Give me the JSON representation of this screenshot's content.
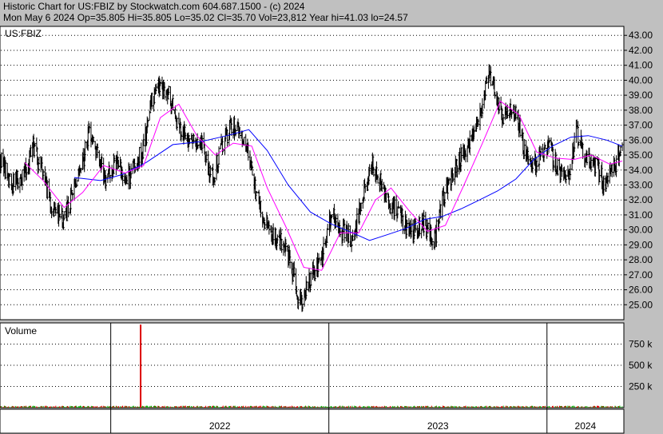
{
  "header": {
    "line1": "Historic Chart for US:FBIZ by Stockwatch.com 604.687.1500 - (c) 2024",
    "line2": "Mon May  6 2024  Op=35.805  Hi=35.805  Lo=35.02  Cl=35.70  Vol=23,812  Year hi=41.03  lo=24.57"
  },
  "chart_data": {
    "type": "line",
    "symbol_label": "US:FBIZ",
    "volume_label": "Volume",
    "price_axis": {
      "ylim": [
        24.0,
        43.6
      ],
      "ticks": [
        25,
        26,
        27,
        28,
        29,
        30,
        31,
        32,
        33,
        34,
        35,
        36,
        37,
        38,
        39,
        40,
        41,
        42,
        43
      ],
      "tick_labels": [
        "25.00",
        "26.00",
        "27.00",
        "28.00",
        "29.00",
        "30.00",
        "31.00",
        "32.00",
        "33.00",
        "34.00",
        "35.00",
        "36.00",
        "37.00",
        "38.00",
        "39.00",
        "40.00",
        "41.00",
        "42.00",
        "43.00"
      ]
    },
    "volume_axis": {
      "ylim": [
        0,
        1000
      ],
      "ticks": [
        250,
        500,
        750
      ],
      "tick_labels": [
        "250 k",
        "500 k",
        "750 k"
      ]
    },
    "x_axis": {
      "start": "2021-07-01",
      "end": "2024-05-06",
      "year_labels": [
        {
          "label": "2022",
          "date": "2022-01-01"
        },
        {
          "label": "2023",
          "date": "2023-01-01"
        },
        {
          "label": "2024",
          "date": "2024-01-01"
        }
      ]
    },
    "colors": {
      "price": "#000000",
      "ma_short": "#ff00ff",
      "ma_long": "#0000ff",
      "volume_up": "#00aa00",
      "volume_down": "#dd0000",
      "volume_spike": "#dd0000"
    },
    "price_path": [
      {
        "date": "2021-07-01",
        "close": 34.8
      },
      {
        "date": "2021-07-20",
        "close": 33.0
      },
      {
        "date": "2021-08-10",
        "close": 33.8
      },
      {
        "date": "2021-08-25",
        "close": 35.6
      },
      {
        "date": "2021-09-10",
        "close": 33.5
      },
      {
        "date": "2021-09-25",
        "close": 31.5
      },
      {
        "date": "2021-10-15",
        "close": 30.6
      },
      {
        "date": "2021-11-01",
        "close": 32.8
      },
      {
        "date": "2021-11-15",
        "close": 34.5
      },
      {
        "date": "2021-11-25",
        "close": 36.3
      },
      {
        "date": "2021-12-10",
        "close": 34.8
      },
      {
        "date": "2021-12-25",
        "close": 33.4
      },
      {
        "date": "2022-01-10",
        "close": 34.4
      },
      {
        "date": "2022-01-25",
        "close": 33.3
      },
      {
        "date": "2022-02-10",
        "close": 34.2
      },
      {
        "date": "2022-02-25",
        "close": 35.5
      },
      {
        "date": "2022-03-10",
        "close": 38.5
      },
      {
        "date": "2022-03-20",
        "close": 39.5
      },
      {
        "date": "2022-04-05",
        "close": 39.3
      },
      {
        "date": "2022-04-20",
        "close": 37.5
      },
      {
        "date": "2022-05-05",
        "close": 36.3
      },
      {
        "date": "2022-05-20",
        "close": 35.7
      },
      {
        "date": "2022-06-05",
        "close": 35.5
      },
      {
        "date": "2022-06-20",
        "close": 33.5
      },
      {
        "date": "2022-07-05",
        "close": 35.5
      },
      {
        "date": "2022-07-20",
        "close": 36.8
      },
      {
        "date": "2022-08-05",
        "close": 36.8
      },
      {
        "date": "2022-08-20",
        "close": 35.2
      },
      {
        "date": "2022-08-31",
        "close": 32.5
      },
      {
        "date": "2022-09-15",
        "close": 30.5
      },
      {
        "date": "2022-10-01",
        "close": 29.5
      },
      {
        "date": "2022-10-20",
        "close": 29.0
      },
      {
        "date": "2022-11-05",
        "close": 26.5
      },
      {
        "date": "2022-11-15",
        "close": 25.0
      },
      {
        "date": "2022-12-01",
        "close": 26.8
      },
      {
        "date": "2022-12-20",
        "close": 28.0
      },
      {
        "date": "2023-01-05",
        "close": 31.0
      },
      {
        "date": "2023-01-20",
        "close": 30.0
      },
      {
        "date": "2023-02-10",
        "close": 29.5
      },
      {
        "date": "2023-03-01",
        "close": 32.5
      },
      {
        "date": "2023-03-15",
        "close": 34.5
      },
      {
        "date": "2023-03-25",
        "close": 33.5
      },
      {
        "date": "2023-04-10",
        "close": 32.0
      },
      {
        "date": "2023-05-01",
        "close": 30.8
      },
      {
        "date": "2023-05-20",
        "close": 29.8
      },
      {
        "date": "2023-06-10",
        "close": 30.5
      },
      {
        "date": "2023-06-25",
        "close": 29.0
      },
      {
        "date": "2023-07-10",
        "close": 32.0
      },
      {
        "date": "2023-07-25",
        "close": 33.5
      },
      {
        "date": "2023-08-10",
        "close": 35.0
      },
      {
        "date": "2023-08-25",
        "close": 36.0
      },
      {
        "date": "2023-09-10",
        "close": 37.5
      },
      {
        "date": "2023-09-25",
        "close": 40.5
      },
      {
        "date": "2023-10-05",
        "close": 39.5
      },
      {
        "date": "2023-10-20",
        "close": 37.5
      },
      {
        "date": "2023-11-05",
        "close": 38.5
      },
      {
        "date": "2023-11-20",
        "close": 36.0
      },
      {
        "date": "2023-12-05",
        "close": 34.0
      },
      {
        "date": "2023-12-20",
        "close": 34.8
      },
      {
        "date": "2024-01-05",
        "close": 35.5
      },
      {
        "date": "2024-01-20",
        "close": 34.0
      },
      {
        "date": "2024-02-05",
        "close": 33.8
      },
      {
        "date": "2024-02-20",
        "close": 36.5
      },
      {
        "date": "2024-03-05",
        "close": 34.8
      },
      {
        "date": "2024-03-20",
        "close": 34.5
      },
      {
        "date": "2024-04-05",
        "close": 33.2
      },
      {
        "date": "2024-04-20",
        "close": 34.0
      },
      {
        "date": "2024-05-06",
        "close": 35.7
      }
    ],
    "ma_short_path": [
      {
        "date": "2021-08-10",
        "v": 34.5
      },
      {
        "date": "2021-09-10",
        "v": 33.3
      },
      {
        "date": "2021-10-15",
        "v": 31.5
      },
      {
        "date": "2021-11-15",
        "v": 32.5
      },
      {
        "date": "2021-12-20",
        "v": 34.3
      },
      {
        "date": "2022-01-25",
        "v": 33.8
      },
      {
        "date": "2022-02-25",
        "v": 34.3
      },
      {
        "date": "2022-03-25",
        "v": 37.5
      },
      {
        "date": "2022-04-25",
        "v": 38.4
      },
      {
        "date": "2022-05-25",
        "v": 36.3
      },
      {
        "date": "2022-06-25",
        "v": 35.0
      },
      {
        "date": "2022-07-25",
        "v": 35.8
      },
      {
        "date": "2022-08-25",
        "v": 35.6
      },
      {
        "date": "2022-09-20",
        "v": 32.8
      },
      {
        "date": "2022-10-20",
        "v": 30.3
      },
      {
        "date": "2022-11-20",
        "v": 27.5
      },
      {
        "date": "2022-12-20",
        "v": 27.3
      },
      {
        "date": "2023-01-20",
        "v": 29.8
      },
      {
        "date": "2023-02-20",
        "v": 29.8
      },
      {
        "date": "2023-03-20",
        "v": 32.0
      },
      {
        "date": "2023-04-15",
        "v": 32.8
      },
      {
        "date": "2023-05-15",
        "v": 31.3
      },
      {
        "date": "2023-06-15",
        "v": 29.9
      },
      {
        "date": "2023-07-15",
        "v": 30.3
      },
      {
        "date": "2023-08-15",
        "v": 33.0
      },
      {
        "date": "2023-09-15",
        "v": 35.8
      },
      {
        "date": "2023-10-15",
        "v": 38.6
      },
      {
        "date": "2023-11-15",
        "v": 37.7
      },
      {
        "date": "2023-12-15",
        "v": 35.2
      },
      {
        "date": "2024-01-15",
        "v": 34.8
      },
      {
        "date": "2024-02-15",
        "v": 34.7
      },
      {
        "date": "2024-03-15",
        "v": 35.0
      },
      {
        "date": "2024-04-15",
        "v": 34.4
      },
      {
        "date": "2024-05-06",
        "v": 34.6
      }
    ],
    "ma_long_path": [
      {
        "date": "2021-11-01",
        "v": 33.5
      },
      {
        "date": "2021-12-15",
        "v": 33.3
      },
      {
        "date": "2022-01-20",
        "v": 33.7
      },
      {
        "date": "2022-03-01",
        "v": 34.5
      },
      {
        "date": "2022-04-15",
        "v": 35.7
      },
      {
        "date": "2022-06-01",
        "v": 35.9
      },
      {
        "date": "2022-07-15",
        "v": 36.3
      },
      {
        "date": "2022-08-20",
        "v": 36.7
      },
      {
        "date": "2022-09-20",
        "v": 35.3
      },
      {
        "date": "2022-10-25",
        "v": 33.0
      },
      {
        "date": "2022-12-01",
        "v": 31.2
      },
      {
        "date": "2023-01-05",
        "v": 30.4
      },
      {
        "date": "2023-02-10",
        "v": 29.8
      },
      {
        "date": "2023-03-10",
        "v": 29.3
      },
      {
        "date": "2023-04-10",
        "v": 29.7
      },
      {
        "date": "2023-05-10",
        "v": 30.1
      },
      {
        "date": "2023-06-10",
        "v": 30.7
      },
      {
        "date": "2023-07-10",
        "v": 30.9
      },
      {
        "date": "2023-08-10",
        "v": 31.4
      },
      {
        "date": "2023-09-10",
        "v": 32.0
      },
      {
        "date": "2023-10-10",
        "v": 32.6
      },
      {
        "date": "2023-11-10",
        "v": 33.4
      },
      {
        "date": "2023-12-10",
        "v": 34.7
      },
      {
        "date": "2024-01-10",
        "v": 35.6
      },
      {
        "date": "2024-02-10",
        "v": 36.2
      },
      {
        "date": "2024-03-10",
        "v": 36.3
      },
      {
        "date": "2024-04-10",
        "v": 36.0
      },
      {
        "date": "2024-05-06",
        "v": 35.6
      }
    ],
    "volume_spike": {
      "date": "2022-02-20",
      "value": 980
    }
  }
}
